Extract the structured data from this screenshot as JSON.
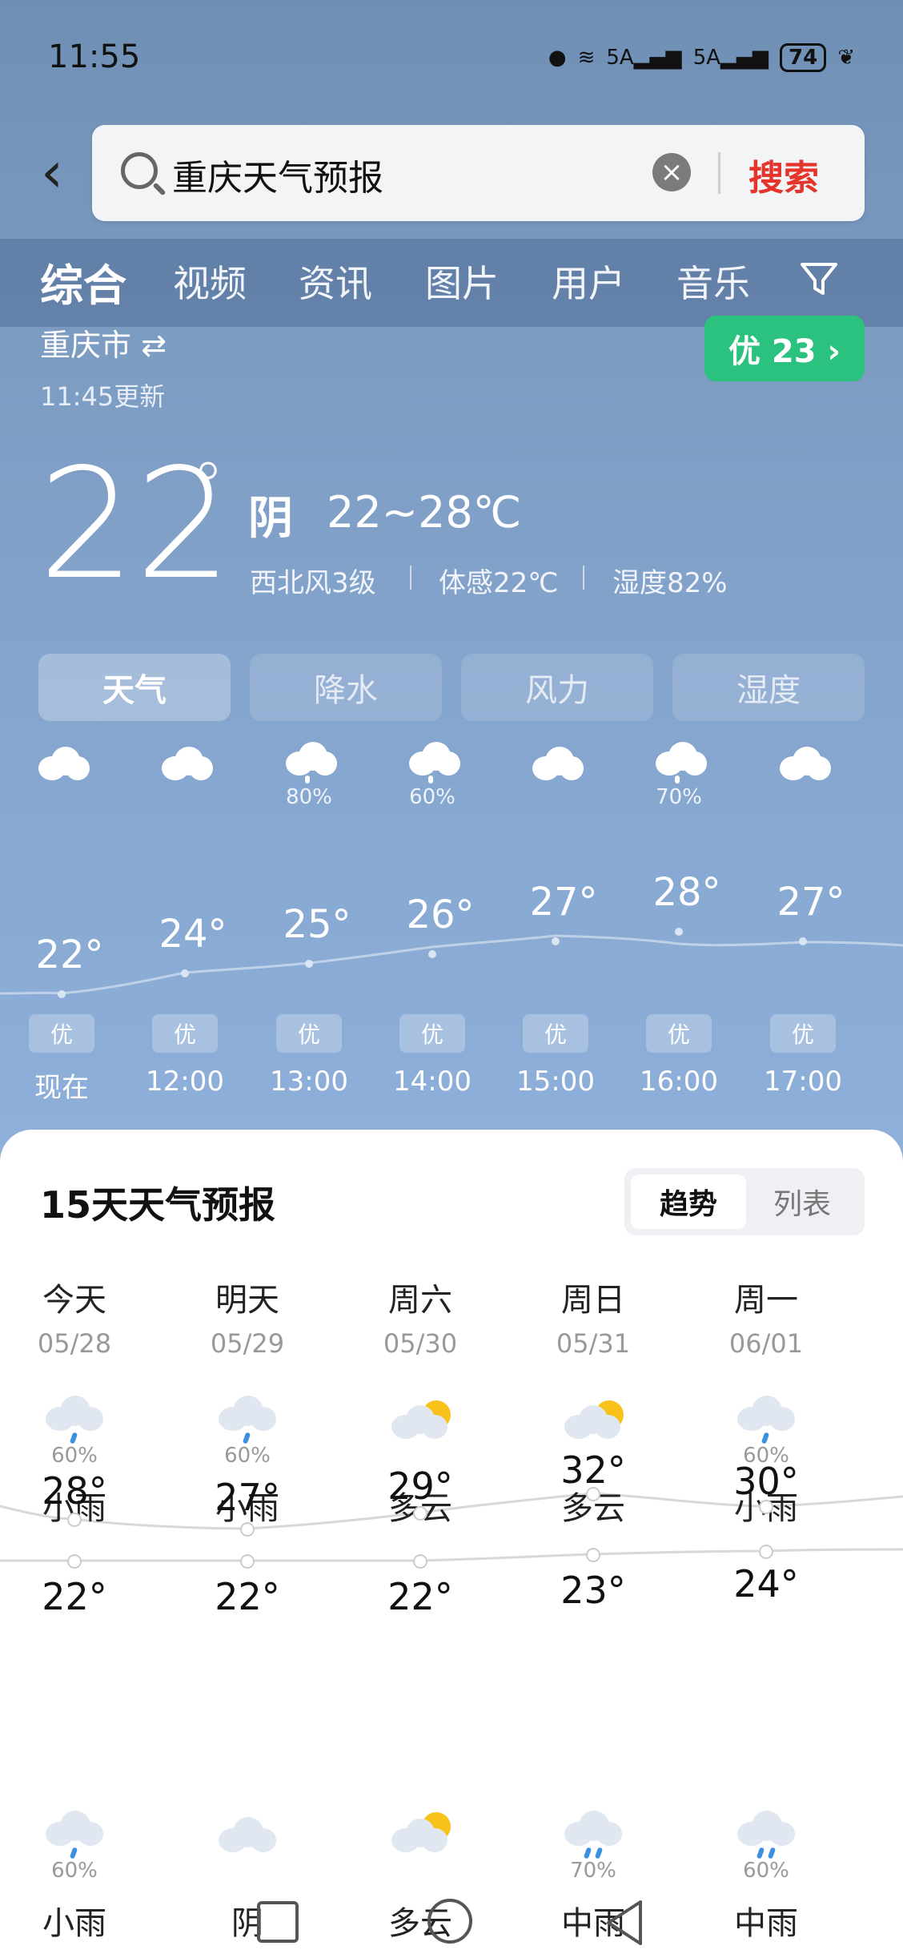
{
  "status": {
    "time": "11:55",
    "signal1": "5A",
    "signal2": "5A",
    "battery": "74"
  },
  "search": {
    "query": "重庆天气预报",
    "button": "搜索"
  },
  "tabs": [
    "综合",
    "视频",
    "资讯",
    "图片",
    "用户",
    "音乐"
  ],
  "city": {
    "name": "重庆市 ⇄",
    "updated": "11:45更新",
    "aqi": "优 23 ›"
  },
  "current": {
    "temp": "22",
    "deg": "°",
    "condition": "阴",
    "range": "22~28℃",
    "wind": "西北风3级",
    "feels": "体感22℃",
    "humidity": "湿度82%"
  },
  "metric_tabs": [
    "天气",
    "降水",
    "风力",
    "湿度"
  ],
  "hourly": [
    {
      "time": "现在",
      "temp": "22°",
      "pct": "",
      "aq": "优"
    },
    {
      "time": "12:00",
      "temp": "24°",
      "pct": "",
      "aq": "优"
    },
    {
      "time": "13:00",
      "temp": "25°",
      "pct": "80%",
      "aq": "优"
    },
    {
      "time": "14:00",
      "temp": "26°",
      "pct": "60%",
      "aq": "优"
    },
    {
      "time": "15:00",
      "temp": "27°",
      "pct": "",
      "aq": "优"
    },
    {
      "time": "16:00",
      "temp": "28°",
      "pct": "70%",
      "aq": "优"
    },
    {
      "time": "17:00",
      "temp": "27°",
      "pct": "",
      "aq": "优"
    }
  ],
  "forecast": {
    "title": "15天天气预报",
    "seg_trend": "趋势",
    "seg_list": "列表",
    "days": [
      {
        "name": "今天",
        "date": "05/28",
        "pct": "60%",
        "cond": "小雨",
        "hi": "28°",
        "lo": "22°",
        "npct": "60%",
        "ncond": "小雨"
      },
      {
        "name": "明天",
        "date": "05/29",
        "pct": "60%",
        "cond": "小雨",
        "hi": "27°",
        "lo": "22°",
        "npct": "",
        "ncond": "阴"
      },
      {
        "name": "周六",
        "date": "05/30",
        "pct": "",
        "cond": "多云",
        "hi": "29°",
        "lo": "22°",
        "npct": "",
        "ncond": "多云"
      },
      {
        "name": "周日",
        "date": "05/31",
        "pct": "",
        "cond": "多云",
        "hi": "32°",
        "lo": "23°",
        "npct": "70%",
        "ncond": "中雨"
      },
      {
        "name": "周一",
        "date": "06/01",
        "pct": "60%",
        "cond": "小雨",
        "hi": "30°",
        "lo": "24°",
        "npct": "60%",
        "ncond": "中雨"
      }
    ]
  }
}
